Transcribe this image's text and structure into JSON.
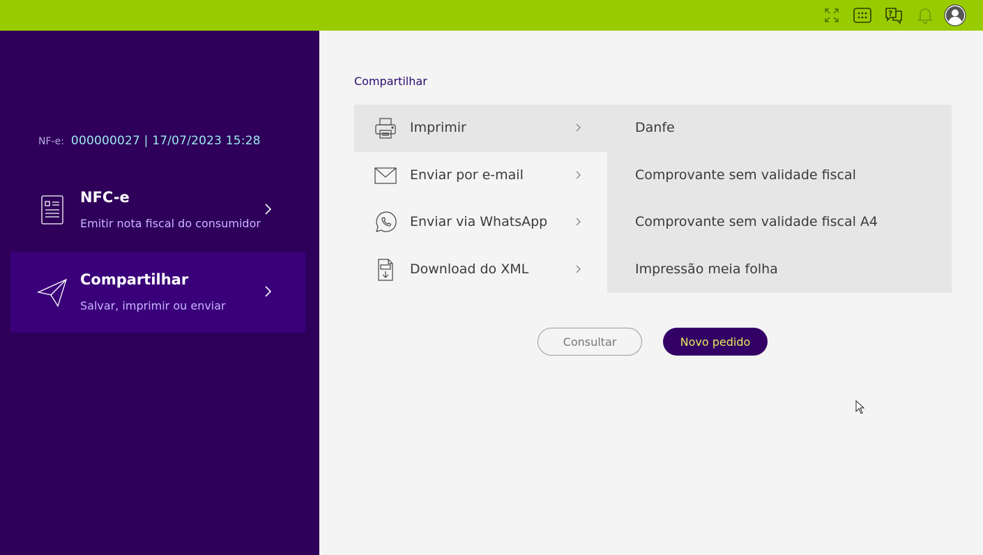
{
  "colors": {
    "topbar": "#99cc00",
    "sidebar": "#2e0059",
    "sidebar_active": "#3a007a",
    "accent_button": "#330066",
    "accent_button_text": "#e6ee5a"
  },
  "topbar": {
    "icons": [
      "expand-icon",
      "apps-grid-icon",
      "help-chat-icon",
      "bell-icon",
      "user-avatar-icon"
    ]
  },
  "sidebar": {
    "nfe_label": "NF-e:",
    "nfe_value": "000000027 | 17/07/2023 15:28",
    "items": [
      {
        "title": "NFC-e",
        "subtitle": "Emitir nota fiscal do consumidor",
        "icon": "document-icon",
        "active": false
      },
      {
        "title": "Compartilhar",
        "subtitle": "Salvar, imprimir ou enviar",
        "icon": "send-icon",
        "active": true
      }
    ]
  },
  "main": {
    "title": "Compartilhar",
    "menu": [
      {
        "label": "Imprimir",
        "icon": "printer-icon",
        "selected": true
      },
      {
        "label": "Enviar por e-mail",
        "icon": "mail-icon",
        "selected": false
      },
      {
        "label": "Enviar via WhatsApp",
        "icon": "whatsapp-icon",
        "selected": false
      },
      {
        "label": "Download do XML",
        "icon": "xml-download-icon",
        "selected": false
      }
    ],
    "print_options": [
      "Danfe",
      "Comprovante sem validade fiscal",
      "Comprovante sem validade fiscal A4",
      "Impressão meia folha"
    ]
  },
  "buttons": {
    "consultar": "Consultar",
    "novo_pedido": "Novo pedido"
  }
}
